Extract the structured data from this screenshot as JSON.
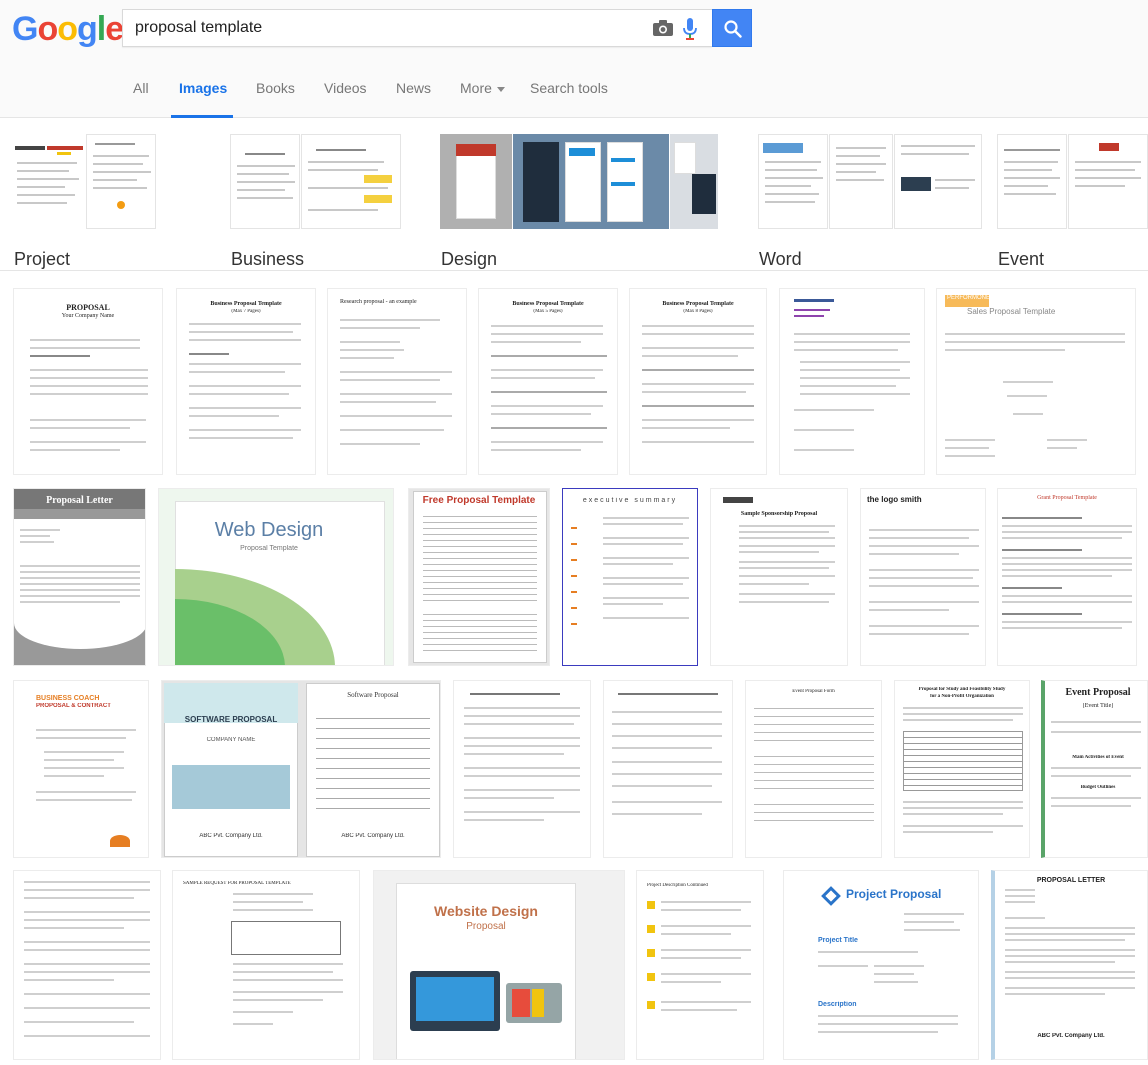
{
  "header": {
    "logo": "Google",
    "search_value": "proposal template",
    "camera_icon": "camera-icon",
    "mic_icon": "mic-icon",
    "search_icon": "search-icon",
    "colors": {
      "blue": "#4285f4",
      "red": "#ea4335",
      "yellow": "#fbbc05",
      "green": "#34a853",
      "tab_active": "#1a73e8"
    }
  },
  "tabs": [
    {
      "label": "All"
    },
    {
      "label": "Images",
      "active": true
    },
    {
      "label": "Books"
    },
    {
      "label": "Videos"
    },
    {
      "label": "News"
    },
    {
      "label": "More",
      "dropdown": true
    },
    {
      "label": "Search tools"
    }
  ],
  "related_topics": [
    {
      "label": "Project"
    },
    {
      "label": "Business"
    },
    {
      "label": "Design"
    },
    {
      "label": "Word"
    },
    {
      "label": "Event"
    }
  ],
  "results": {
    "row1": [
      {
        "title": "PROPOSAL",
        "sub": "Your Company Name"
      },
      {
        "title": "Business Proposal Template",
        "sub": "(Max 7 Pages)"
      },
      {
        "title": "Research proposal - an example",
        "sub": ""
      },
      {
        "title": "Business Proposal Template",
        "sub": "(Max 5 Pages)"
      },
      {
        "title": "Business Proposal Template",
        "sub": "(Max 8 Pages)"
      },
      {
        "title": "",
        "sub": ""
      },
      {
        "title": "Sales Proposal Template",
        "sub": "PERFORMONE"
      },
      {
        "title": "",
        "sub": ""
      }
    ],
    "row2": [
      {
        "title": "Proposal Letter",
        "sub": ""
      },
      {
        "title": "Web Design",
        "sub": "Proposal Template"
      },
      {
        "title": "Free Proposal Template",
        "sub": ""
      },
      {
        "title": "executive summary",
        "sub": ""
      },
      {
        "title": "Sample Sponsorship Proposal",
        "sub": ""
      },
      {
        "title": "the logo smith",
        "sub": ""
      },
      {
        "title": "Grant Proposal Template",
        "sub": ""
      }
    ],
    "row3": [
      {
        "title": "BUSINESS COACH",
        "sub": "PROPOSAL & CONTRACT"
      },
      {
        "title": "SOFTWARE PROPOSAL",
        "sub": "COMPANY NAME",
        "footer": "ABC Pvt. Company Ltd."
      },
      {
        "title": "Software Proposal",
        "sub": "",
        "footer": "ABC Pvt. Company Ltd."
      },
      {
        "title": "",
        "sub": ""
      },
      {
        "title": "",
        "sub": ""
      },
      {
        "title": "Event Proposal Form",
        "sub": ""
      },
      {
        "title": "Proposal for Study and Feasibility Study",
        "sub": "for a Non-Profit Organization"
      },
      {
        "title": "Event Proposal",
        "sub": "[Event Title]",
        "section1": "Main Activities of Event",
        "section2": "Budget Outlines"
      }
    ],
    "row4": [
      {
        "title": "",
        "sub": ""
      },
      {
        "title": "SAMPLE REQUEST FOR PROPOSAL TEMPLATE",
        "sub": ""
      },
      {
        "title": "Website Design",
        "sub": "Proposal"
      },
      {
        "title": "Project Description Continued",
        "sub": ""
      },
      {
        "title": "Project Proposal",
        "sub": "Project Title",
        "section": "Description"
      },
      {
        "title": "PROPOSAL LETTER",
        "sub": "",
        "footer": "ABC Pvt. Company Ltd."
      }
    ]
  }
}
